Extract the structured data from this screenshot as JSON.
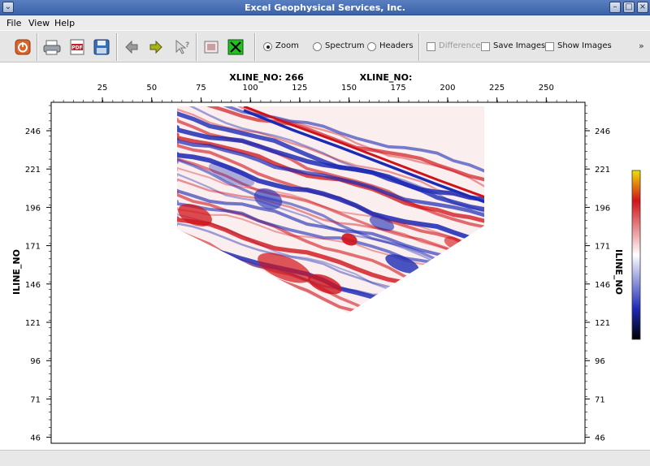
{
  "window": {
    "title": "Excel Geophysical Services, Inc."
  },
  "menu": {
    "items": [
      "File",
      "View",
      "Help"
    ]
  },
  "toolbar": {
    "zoom_label": "Zoom",
    "spectrum_label": "Spectrum",
    "headers_label": "Headers",
    "difference_label": "Difference",
    "save_images_label": "Save Images",
    "show_images_label": "Show Images",
    "more_label": "»",
    "selected_mode": "Zoom"
  },
  "plot": {
    "x_title": "XLINE_NO: 266",
    "x_title_right": "XLINE_NO:",
    "y_title_left": "ILINE_NO",
    "y_title_right": "ILINE_NO",
    "x_ticks": [
      "25",
      "50",
      "75",
      "100",
      "125",
      "150",
      "175",
      "200",
      "225",
      "250"
    ],
    "y_ticks": [
      "246",
      "221",
      "196",
      "171",
      "146",
      "121",
      "96",
      "71",
      "46"
    ],
    "colors": {
      "positive": "#d0131a",
      "negative": "#1c2bb5",
      "neutral": "#ffffff",
      "peak": "#f0e000",
      "trough": "#000000"
    }
  }
}
